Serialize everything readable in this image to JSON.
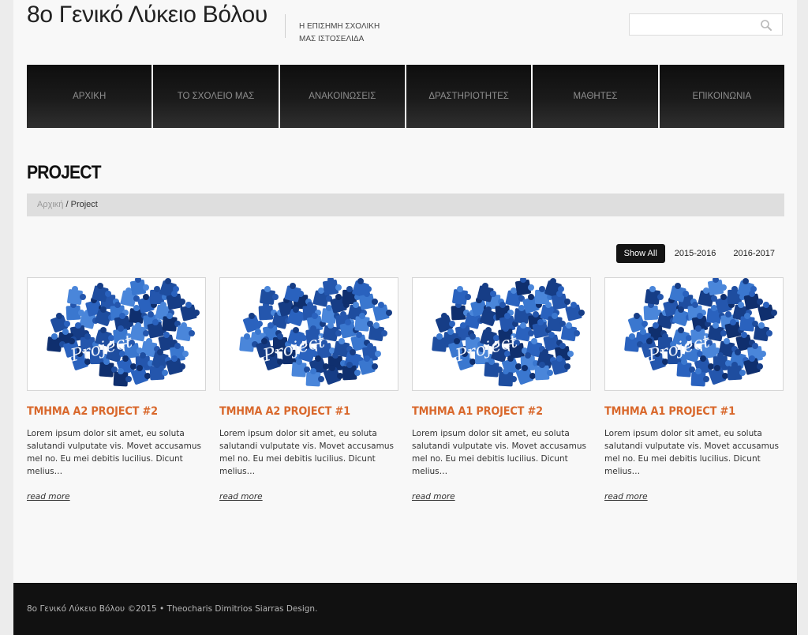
{
  "header": {
    "site_title": "8ο Γενικό Λύκειο Βόλου",
    "tagline_line1": "Η ΕΠΙΣΗΜΗ ΣΧΟΛΙΚΗ",
    "tagline_line2": "ΜΑΣ ΙΣΤΟΣΕΛΙΔΑ",
    "search": {
      "value": "",
      "placeholder": "",
      "icon": "search-icon"
    }
  },
  "nav": {
    "items": [
      {
        "label": "ΑΡΧΙΚΗ"
      },
      {
        "label": "ΤΟ ΣΧΟΛΕΙΟ ΜΑΣ"
      },
      {
        "label": "ΑΝΑΚΟΙΝΩΣΕΙΣ"
      },
      {
        "label": "ΔΡΑΣΤΗΡΙΟΤΗΤΕΣ"
      },
      {
        "label": "ΜΑΘΗΤΕΣ"
      },
      {
        "label": "ΕΠΙΚΟΙΝΩΝΙΑ"
      }
    ]
  },
  "page": {
    "heading": "PROJECT",
    "breadcrumb": {
      "home": "Αρχική",
      "separator": " / ",
      "current": "Project"
    }
  },
  "filters": {
    "items": [
      {
        "label": "Show All",
        "active": true
      },
      {
        "label": "2015-2016",
        "active": false
      },
      {
        "label": "2016-2017",
        "active": false
      }
    ]
  },
  "projects": [
    {
      "title": "ΤΜΗΜΑ Α2 PROJECT #2",
      "image_text": "Project",
      "excerpt": "Lorem ipsum dolor sit amet, eu soluta salutandi vulputate vis. Movet accusamus mel no. Eu mei debitis lucilius. Dicunt melius…",
      "link": "read more"
    },
    {
      "title": "ΤΜΗΜΑ Α2 PROJECT #1",
      "image_text": "Project",
      "excerpt": "Lorem ipsum dolor sit amet, eu soluta salutandi vulputate vis. Movet accusamus mel no. Eu mei debitis lucilius. Dicunt melius…",
      "link": "read more"
    },
    {
      "title": "ΤΜΗΜΑ Α1 PROJECT #2",
      "image_text": "Project",
      "excerpt": "Lorem ipsum dolor sit amet, eu soluta salutandi vulputate vis. Movet accusamus mel no. Eu mei debitis lucilius. Dicunt melius…",
      "link": "read more"
    },
    {
      "title": "ΤΜΗΜΑ Α1 PROJECT #1",
      "image_text": "Project",
      "excerpt": "Lorem ipsum dolor sit amet, eu soluta salutandi vulputate vis. Movet accusamus mel no. Eu mei debitis lucilius. Dicunt melius…",
      "link": "read more"
    }
  ],
  "footer": {
    "text": "8ο Γενικό Λύκειο Βόλου ©2015 • Theocharis Dimitrios Siarras Design."
  },
  "colors": {
    "accent": "#d9682c",
    "nav_bg": "#1b1b1b",
    "footer_bg": "#111111",
    "puzzle_blue": "#1f4fa8"
  }
}
